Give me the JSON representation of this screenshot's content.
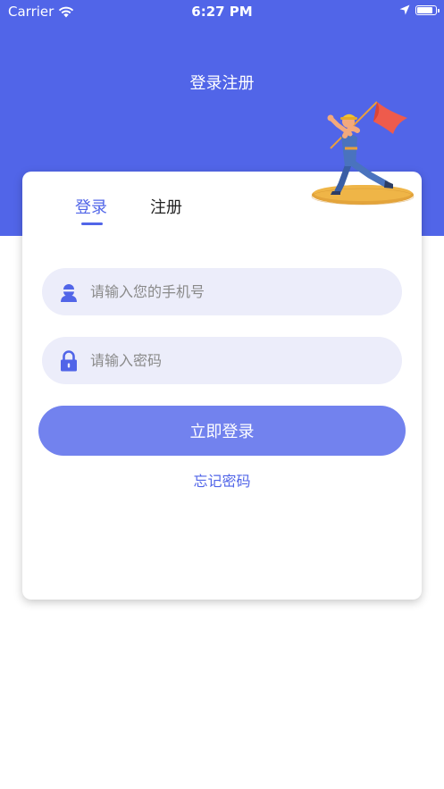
{
  "status_bar": {
    "carrier": "Carrier",
    "time": "6:27 PM",
    "icons": [
      "wifi-icon",
      "location-arrow-icon",
      "battery-icon"
    ]
  },
  "header": {
    "title": "登录注册",
    "background_color": "#5165e8"
  },
  "tabs": {
    "login_label": "登录",
    "register_label": "注册",
    "active": "login"
  },
  "form": {
    "phone_placeholder": "请输入您的手机号",
    "phone_value": "",
    "phone_icon": "user-icon",
    "password_placeholder": "请输入密码",
    "password_value": "",
    "password_icon": "lock-icon",
    "submit_label": "立即登录",
    "forgot_label": "忘记密码"
  },
  "colors": {
    "accent": "#5165e8",
    "button": "#7282ee",
    "field_bg": "#ecedfa"
  }
}
